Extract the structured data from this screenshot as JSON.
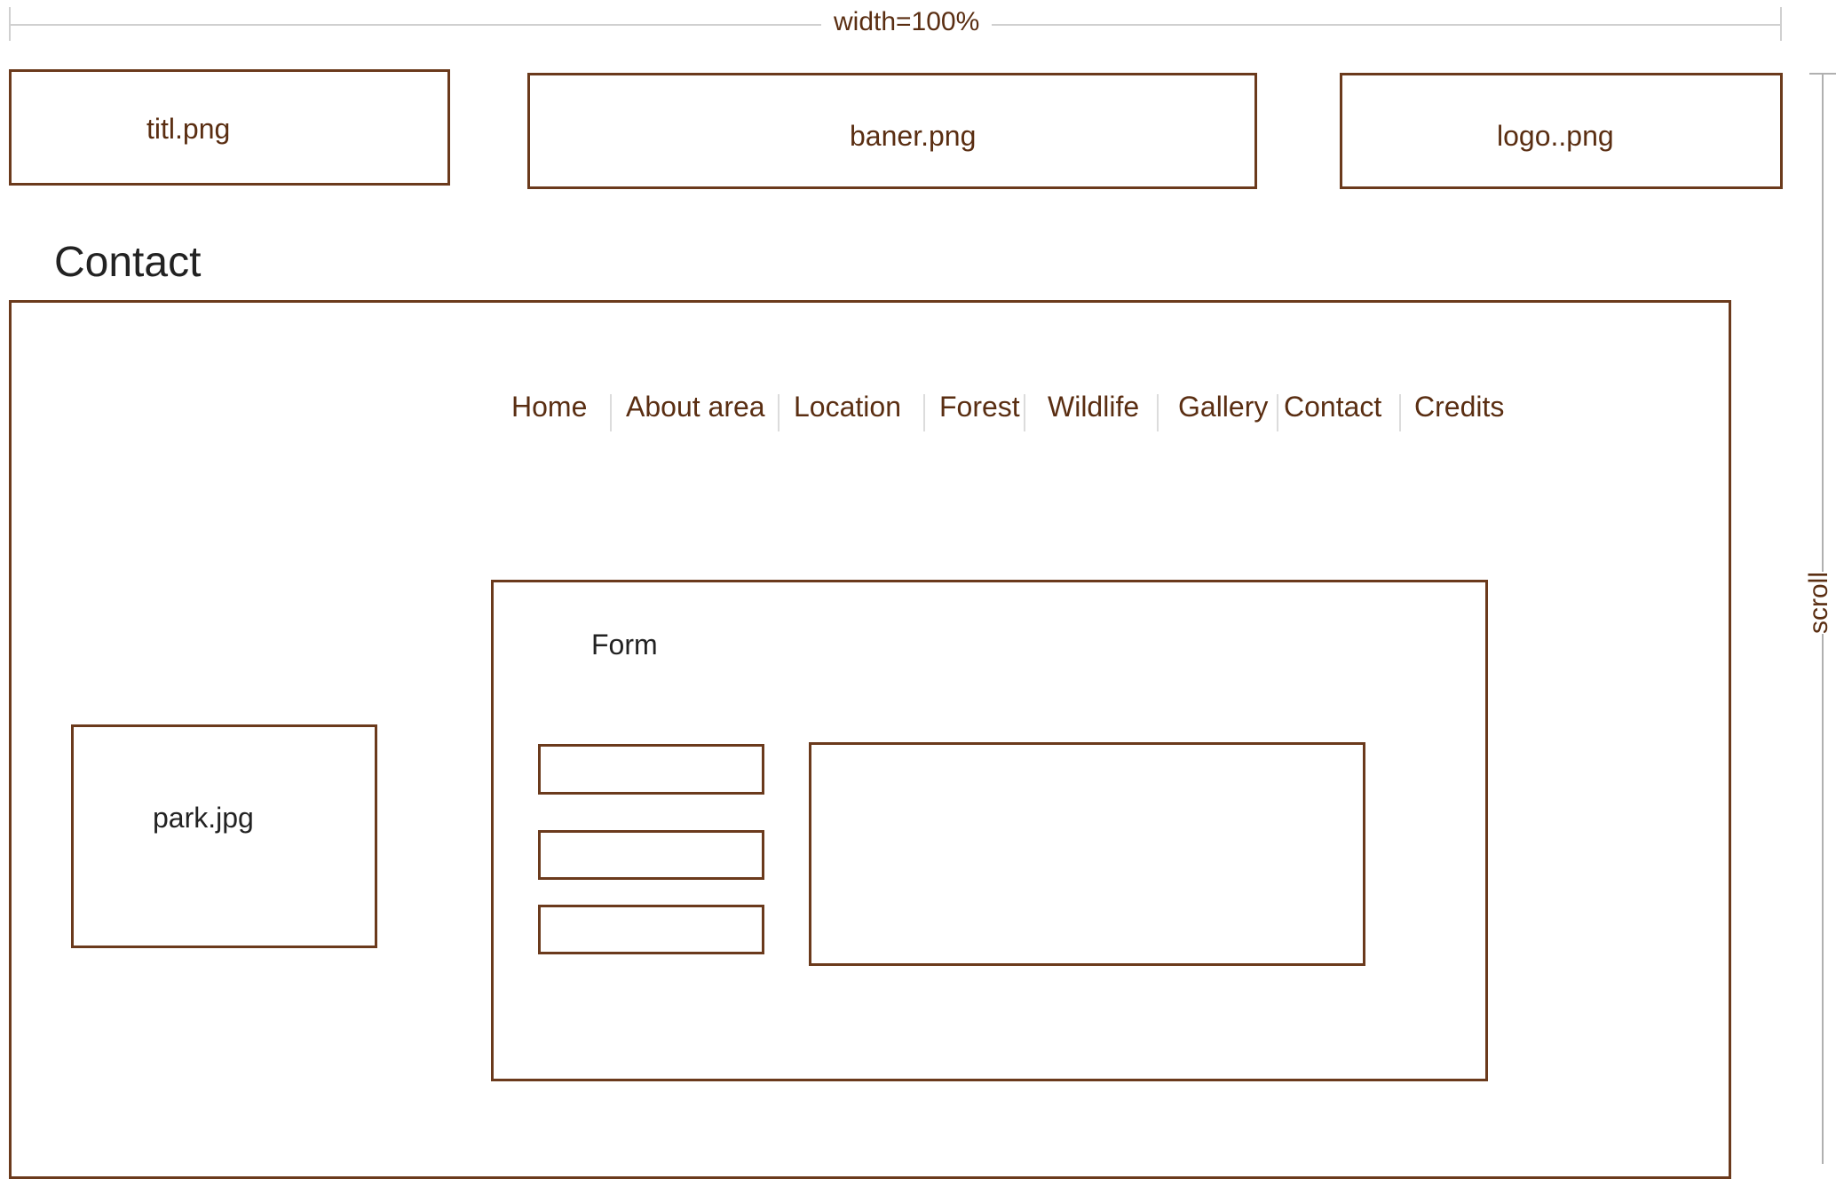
{
  "width_annotation": "width=100%",
  "scroll_annotation": "scroll",
  "header": {
    "title_image": "titl.png",
    "banner_image": "baner.png",
    "logo_image": "logo..png"
  },
  "page_heading": "Contact",
  "nav": {
    "items": [
      {
        "label": "Home"
      },
      {
        "label": "About area"
      },
      {
        "label": "Location"
      },
      {
        "label": "Forest"
      },
      {
        "label": "Wildlife"
      },
      {
        "label": "Gallery"
      },
      {
        "label": "Contact"
      },
      {
        "label": "Credits"
      }
    ]
  },
  "sidebar_image": "park.jpg",
  "form": {
    "title": "Form"
  },
  "colors": {
    "outline": "#6b3a1c",
    "text": "#5a2e12",
    "annotation_line": "#d0d0d0"
  }
}
